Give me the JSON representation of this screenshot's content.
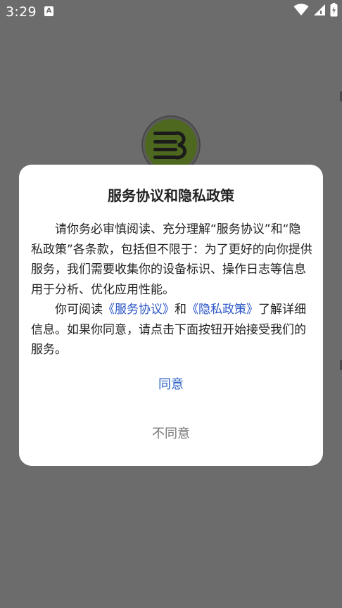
{
  "status_bar": {
    "time": "3:29",
    "notification_icon": "a-letter-icon",
    "icons": [
      "wifi-icon",
      "signal-icon",
      "battery-icon"
    ],
    "text_color": "#ffffff"
  },
  "background": {
    "scrim_color": "#6c6c6c",
    "logo_icon": "book-logo-icon",
    "logo_color": "#4e6b16"
  },
  "dialog": {
    "title": "服务协议和隐私政策",
    "paragraph1": "请你务必审慎阅读、充分理解“服务协议”和“隐私政策”各条款，包括但不限于：为了更好的向你提供服务，我们需要收集你的设备标识、操作日志等信息用于分析、优化应用性能。",
    "paragraph2_prefix": "你可阅读",
    "service_link": "《服务协议》",
    "paragraph2_and": "和",
    "privacy_link": "《隐私政策》",
    "paragraph2_suffix": "了解详细信息。如果你同意，请点击下面按钮开始接受我们的服务。",
    "agree_label": "同意",
    "disagree_label": "不同意",
    "link_color": "#2a55c6",
    "agree_color": "#2d63c4"
  }
}
